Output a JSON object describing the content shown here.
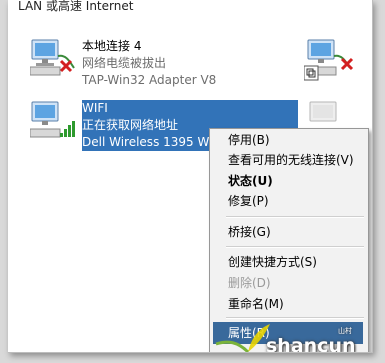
{
  "header": {
    "title": "LAN 或高速 Internet"
  },
  "connections": [
    {
      "name": "本地连接 4",
      "status": "网络电缆被拔出",
      "device": "TAP-Win32 Adapter V8"
    },
    {
      "name": "WIFI",
      "status": "正在获取网络地址",
      "device": "Dell Wireless 1395 W"
    }
  ],
  "context_menu": {
    "items": [
      {
        "label": "停用(B)"
      },
      {
        "label": "查看可用的无线连接(V)"
      },
      {
        "label": "状态(U)"
      },
      {
        "label": "修复(P)"
      },
      {
        "label": "桥接(G)"
      },
      {
        "label": "创建快捷方式(S)"
      },
      {
        "label": "删除(D)"
      },
      {
        "label": "重命名(M)"
      },
      {
        "label": "属性(R)"
      }
    ]
  },
  "watermark": {
    "text": "shancun",
    "sub": "山村"
  },
  "colors": {
    "selection": "#3273b8",
    "menu_highlight": "#39699b",
    "error_x": "#d32020"
  }
}
